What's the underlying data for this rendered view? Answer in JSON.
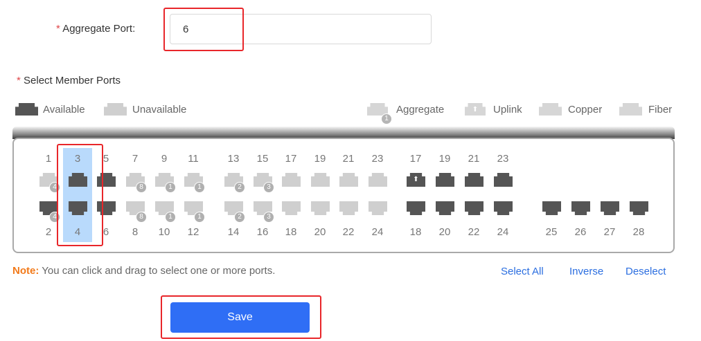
{
  "form": {
    "aggregate_port_label": "Aggregate Port:",
    "aggregate_port_value": "6",
    "member_ports_label": "Select Member Ports",
    "required_mark": "*"
  },
  "legend": {
    "available": "Available",
    "unavailable": "Unavailable",
    "aggregate": "Aggregate",
    "aggregate_badge": "1",
    "uplink": "Uplink",
    "copper": "Copper",
    "fiber": "Fiber"
  },
  "ports": {
    "top_numbers": [
      "1",
      "3",
      "5",
      "7",
      "9",
      "11",
      "13",
      "15",
      "17",
      "19",
      "21",
      "23",
      "17",
      "19",
      "21",
      "23"
    ],
    "bottom_numbers": [
      "2",
      "4",
      "6",
      "8",
      "10",
      "12",
      "14",
      "16",
      "18",
      "20",
      "22",
      "24",
      "18",
      "20",
      "22",
      "24",
      "25",
      "26",
      "27",
      "28"
    ],
    "badges": {
      "p1": "4",
      "p2": "4",
      "p7": "8",
      "p8": "8",
      "p9": "1",
      "p10": "1",
      "p11": "1",
      "p12": "1",
      "p13": "2",
      "p14": "2",
      "p15": "3",
      "p16": "3"
    },
    "selected": [
      "3",
      "4"
    ]
  },
  "note": {
    "prefix": "Note:",
    "text": " You can click and drag to select one or more ports."
  },
  "actions": {
    "select_all": "Select All",
    "inverse": "Inverse",
    "deselect": "Deselect",
    "save": "Save"
  },
  "colors": {
    "available": "#555555",
    "unavailable": "#cfcfcf",
    "selection": "#b9dafc",
    "save_button": "#2f6ef5",
    "highlight_box": "#e8262a",
    "note_prefix": "#f27a1a",
    "link": "#2b6ee0"
  },
  "icons": {
    "port": "rj45-port-icon",
    "uplink": "up-arrow-icon"
  }
}
